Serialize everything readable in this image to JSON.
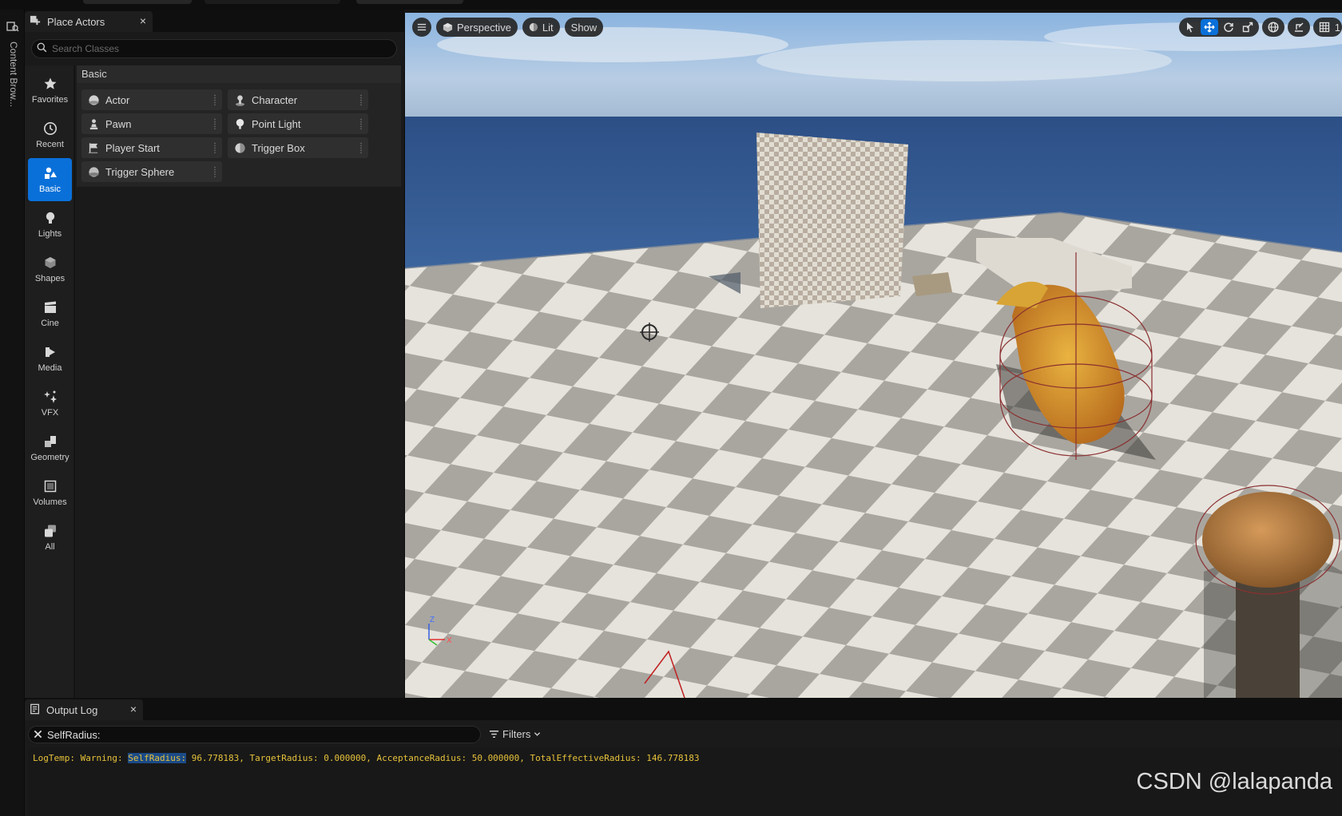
{
  "place_actors": {
    "tab_title": "Place Actors",
    "close_glyph": "×",
    "search_placeholder": "Search Classes",
    "categories": [
      {
        "label": "Favorites",
        "icon": "star-icon"
      },
      {
        "label": "Recent",
        "icon": "clock-icon"
      },
      {
        "label": "Basic",
        "icon": "basic-shapes-icon"
      },
      {
        "label": "Lights",
        "icon": "lightbulb-icon"
      },
      {
        "label": "Shapes",
        "icon": "cube-icon"
      },
      {
        "label": "Cine",
        "icon": "clapper-icon"
      },
      {
        "label": "Media",
        "icon": "media-icon"
      },
      {
        "label": "VFX",
        "icon": "sparkle-icon"
      },
      {
        "label": "Geometry",
        "icon": "geometry-icon"
      },
      {
        "label": "Volumes",
        "icon": "volume-icon"
      },
      {
        "label": "All",
        "icon": "stack-icon"
      }
    ],
    "active_category": "Basic",
    "section_header": "Basic",
    "actors": [
      {
        "label": "Actor",
        "icon": "sphere-icon"
      },
      {
        "label": "Character",
        "icon": "character-icon"
      },
      {
        "label": "Pawn",
        "icon": "pawn-icon"
      },
      {
        "label": "Point Light",
        "icon": "point-light-icon"
      },
      {
        "label": "Player Start",
        "icon": "flag-icon"
      },
      {
        "label": "Trigger Box",
        "icon": "trigger-box-icon"
      },
      {
        "label": "Trigger Sphere",
        "icon": "trigger-sphere-icon"
      }
    ]
  },
  "left_dock": {
    "content_browser_label": "Content Brow..."
  },
  "viewport": {
    "perspective_label": "Perspective",
    "lit_label": "Lit",
    "show_label": "Show",
    "overflow_label": "1",
    "axis_labels": {
      "z": "Z",
      "x": "X"
    }
  },
  "output_log": {
    "tab_title": "Output Log",
    "close_glyph": "×",
    "filter_value": "SelfRadius:",
    "filters_label": "Filters",
    "log_prefix": "LogTemp: Warning: ",
    "log_highlight": "SelfRadius:",
    "log_rest": " 96.778183, TargetRadius: 0.000000, AcceptanceRadius: 50.000000, TotalEffectiveRadius: 146.778183"
  },
  "watermark": "CSDN @lalapanda",
  "colors": {
    "accent": "#0a70d9",
    "panel": "#1a1a1a",
    "log_warning": "#e6c23a"
  }
}
